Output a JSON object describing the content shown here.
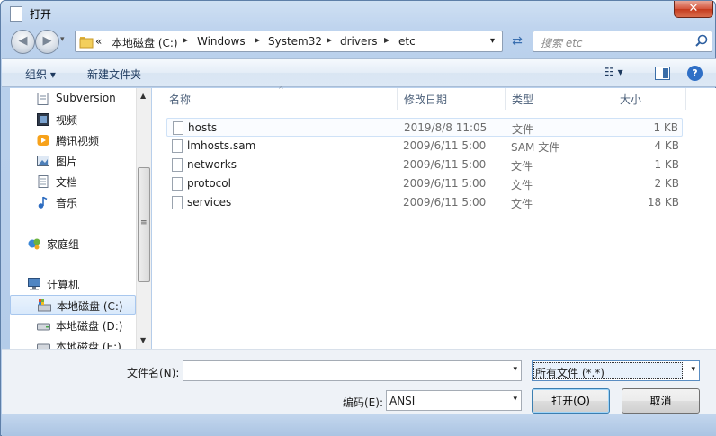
{
  "window": {
    "title": "打开",
    "close_glyph": "✕"
  },
  "nav": {
    "back_glyph": "◀",
    "forward_glyph": "▶",
    "history_glyph": "▾"
  },
  "address": {
    "overflow": "«",
    "crumbs": [
      "本地磁盘 (C:)",
      "Windows",
      "System32",
      "drivers",
      "etc"
    ],
    "dropdown_glyph": "▾",
    "refresh_glyph": "⇄"
  },
  "search": {
    "placeholder": "搜索 etc"
  },
  "toolbar": {
    "organize": "组织 ▾",
    "new_folder": "新建文件夹",
    "views_glyph": "☷ ▾",
    "help_glyph": "?"
  },
  "sidebar": {
    "items": [
      {
        "label": "Subversion",
        "icon": "subversion-icon"
      },
      {
        "label": "视频",
        "icon": "video-icon"
      },
      {
        "label": "腾讯视频",
        "icon": "tencent-video-icon"
      },
      {
        "label": "图片",
        "icon": "pictures-icon"
      },
      {
        "label": "文档",
        "icon": "documents-icon"
      },
      {
        "label": "音乐",
        "icon": "music-icon"
      },
      {
        "label": "家庭组",
        "icon": "homegroup-icon"
      },
      {
        "label": "计算机",
        "icon": "computer-icon"
      },
      {
        "label": "本地磁盘 (C:)",
        "icon": "drive-c-icon"
      },
      {
        "label": "本地磁盘 (D:)",
        "icon": "drive-d-icon"
      },
      {
        "label": "本地磁盘 (E:)",
        "icon": "drive-e-icon"
      }
    ],
    "scroll_up": "▲",
    "scroll_down": "▼",
    "grip": "≡"
  },
  "filelist": {
    "columns": {
      "name": "名称",
      "modified": "修改日期",
      "type": "类型",
      "size": "大小"
    },
    "sort_glyph": "^",
    "rows": [
      {
        "name": "hosts",
        "modified": "2019/8/8 11:05",
        "type": "文件",
        "size": "1 KB"
      },
      {
        "name": "lmhosts.sam",
        "modified": "2009/6/11 5:00",
        "type": "SAM 文件",
        "size": "4 KB"
      },
      {
        "name": "networks",
        "modified": "2009/6/11 5:00",
        "type": "文件",
        "size": "1 KB"
      },
      {
        "name": "protocol",
        "modified": "2009/6/11 5:00",
        "type": "文件",
        "size": "2 KB"
      },
      {
        "name": "services",
        "modified": "2009/6/11 5:00",
        "type": "文件",
        "size": "18 KB"
      }
    ]
  },
  "form": {
    "filename_label": "文件名(N):",
    "filename_value": "",
    "filter_value": "所有文件  (*.*)",
    "encoding_label": "编码(E):",
    "encoding_value": "ANSI",
    "combo_glyph": "▾",
    "open_label": "打开(O)",
    "cancel_label": "取消"
  }
}
